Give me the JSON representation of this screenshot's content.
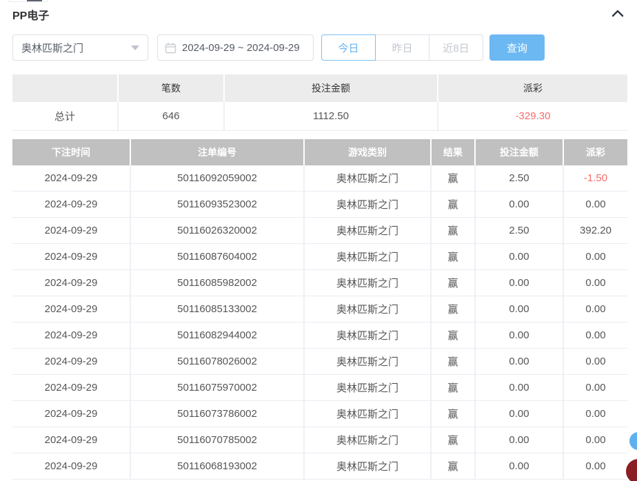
{
  "page": {
    "title": "PP电子"
  },
  "header": {
    "collapse_icon": "chevron-up-icon"
  },
  "controls": {
    "game_select": {
      "value": "奥林匹斯之门",
      "caret_icon": "chevron-down-icon"
    },
    "date_range": {
      "value": "2024-09-29 ~ 2024-09-29",
      "icon": "calendar-icon"
    },
    "quick_buttons": [
      {
        "label": "今日",
        "active": true
      },
      {
        "label": "昨日",
        "active": false
      },
      {
        "label": "近8日",
        "active": false
      }
    ],
    "search_button_label": "查询"
  },
  "summary_table": {
    "headers": [
      "",
      "笔数",
      "投注金额",
      "派彩"
    ],
    "total_row": {
      "label": "总计",
      "count": "646",
      "bet_amount": "1112.50",
      "payout": "-329.30"
    }
  },
  "bet_table": {
    "headers": [
      "下注时间",
      "注单编号",
      "游戏类别",
      "结果",
      "投注金额",
      "派彩"
    ],
    "rows": [
      {
        "date": "2024-09-29",
        "order_no": "50116092059002",
        "game": "奥林匹斯之门",
        "result": "赢",
        "bet": "2.50",
        "payout": "-1.50"
      },
      {
        "date": "2024-09-29",
        "order_no": "50116093523002",
        "game": "奥林匹斯之门",
        "result": "赢",
        "bet": "0.00",
        "payout": "0.00"
      },
      {
        "date": "2024-09-29",
        "order_no": "50116026320002",
        "game": "奥林匹斯之门",
        "result": "赢",
        "bet": "2.50",
        "payout": "392.20"
      },
      {
        "date": "2024-09-29",
        "order_no": "50116087604002",
        "game": "奥林匹斯之门",
        "result": "赢",
        "bet": "0.00",
        "payout": "0.00"
      },
      {
        "date": "2024-09-29",
        "order_no": "50116085982002",
        "game": "奥林匹斯之门",
        "result": "赢",
        "bet": "0.00",
        "payout": "0.00"
      },
      {
        "date": "2024-09-29",
        "order_no": "50116085133002",
        "game": "奥林匹斯之门",
        "result": "赢",
        "bet": "0.00",
        "payout": "0.00"
      },
      {
        "date": "2024-09-29",
        "order_no": "50116082944002",
        "game": "奥林匹斯之门",
        "result": "赢",
        "bet": "0.00",
        "payout": "0.00"
      },
      {
        "date": "2024-09-29",
        "order_no": "50116078026002",
        "game": "奥林匹斯之门",
        "result": "赢",
        "bet": "0.00",
        "payout": "0.00"
      },
      {
        "date": "2024-09-29",
        "order_no": "50116075970002",
        "game": "奥林匹斯之门",
        "result": "赢",
        "bet": "0.00",
        "payout": "0.00"
      },
      {
        "date": "2024-09-29",
        "order_no": "50116073786002",
        "game": "奥林匹斯之门",
        "result": "赢",
        "bet": "0.00",
        "payout": "0.00"
      },
      {
        "date": "2024-09-29",
        "order_no": "50116070785002",
        "game": "奥林匹斯之门",
        "result": "赢",
        "bet": "0.00",
        "payout": "0.00"
      },
      {
        "date": "2024-09-29",
        "order_no": "50116068193002",
        "game": "奥林匹斯之门",
        "result": "赢",
        "bet": "0.00",
        "payout": "0.00"
      }
    ]
  },
  "colors": {
    "accent_blue": "#6cb8f2",
    "negative_red": "#f56c6c",
    "bet_header_gray": "#c0c0c0",
    "summary_header_gray": "#ececec",
    "floating_button_blue": "#5fb0ee",
    "floating_button_red": "#8a1e24"
  }
}
